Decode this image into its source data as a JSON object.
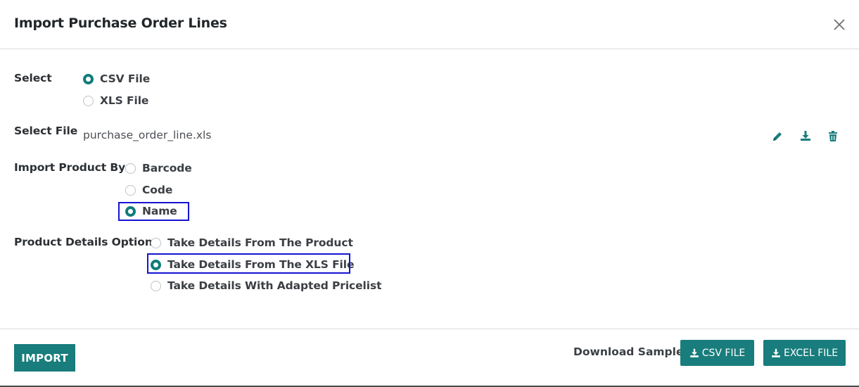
{
  "dialog": {
    "title": "Import Purchase Order Lines"
  },
  "select": {
    "label": "Select",
    "options": [
      {
        "label": "CSV File",
        "checked": true
      },
      {
        "label": "XLS File",
        "checked": false
      }
    ]
  },
  "select_file": {
    "label": "Select File",
    "filename": "purchase_order_line.xls",
    "icons": [
      "pencil-icon",
      "download-icon",
      "trash-icon"
    ]
  },
  "import_product_by": {
    "label": "Import Product By",
    "options": [
      {
        "label": "Barcode",
        "checked": false
      },
      {
        "label": "Code",
        "checked": false
      },
      {
        "label": "Name",
        "checked": true
      }
    ]
  },
  "product_details": {
    "label": "Product Details Option",
    "options": [
      {
        "label": "Take Details From The Product",
        "checked": false
      },
      {
        "label": "Take Details From The XLS File",
        "checked": true
      },
      {
        "label": "Take Details With Adapted Pricelist",
        "checked": false
      }
    ]
  },
  "footer": {
    "import_label": "IMPORT",
    "download_label": "Download Sample:",
    "csv_button": "CSV FILE",
    "excel_button": "EXCEL FILE"
  },
  "colors": {
    "accent": "#187d7c",
    "highlight": "#1414d4"
  }
}
